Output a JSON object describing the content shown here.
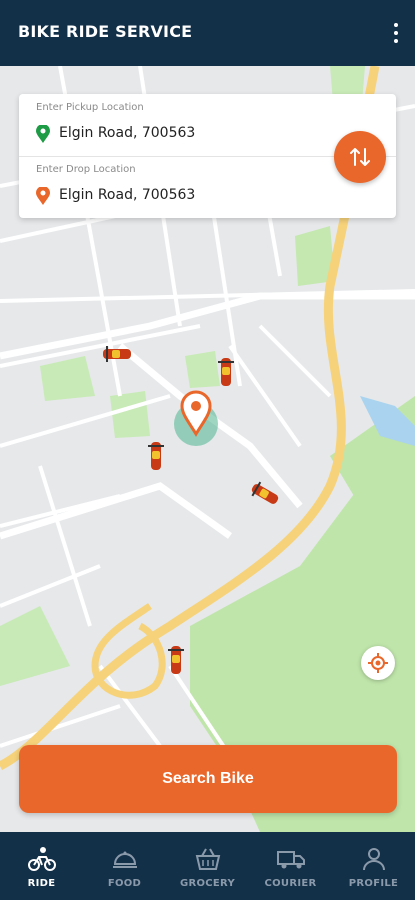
{
  "app": {
    "title": "BIKE RIDE SERVICE",
    "menu_icon": "more-vert-icon"
  },
  "locations": {
    "pickup": {
      "label": "Enter Pickup Location",
      "value": "Elgin Road, 700563",
      "pin_color": "#1e9b45"
    },
    "drop": {
      "label": "Enter Drop Location",
      "value": "Elgin Road, 700563",
      "pin_color": "#e9672b"
    }
  },
  "actions": {
    "search_label": "Search Bike",
    "swap_icon": "swap-vertical-icon",
    "locate_icon": "my-location-icon"
  },
  "colors": {
    "accent": "#e9672b",
    "nav_bg": "#133049",
    "nav_inactive": "#8b9aaa",
    "map_road_major": "#f6d27a",
    "map_park": "#b9e3a3"
  },
  "nav": [
    {
      "label": "RIDE",
      "icon": "bike-rider-icon",
      "active": true
    },
    {
      "label": "FOOD",
      "icon": "food-cloche-icon",
      "active": false
    },
    {
      "label": "GROCERY",
      "icon": "grocery-basket-icon",
      "active": false
    },
    {
      "label": "COURIER",
      "icon": "courier-truck-icon",
      "active": false
    },
    {
      "label": "PROFILE",
      "icon": "profile-icon",
      "active": false
    }
  ]
}
